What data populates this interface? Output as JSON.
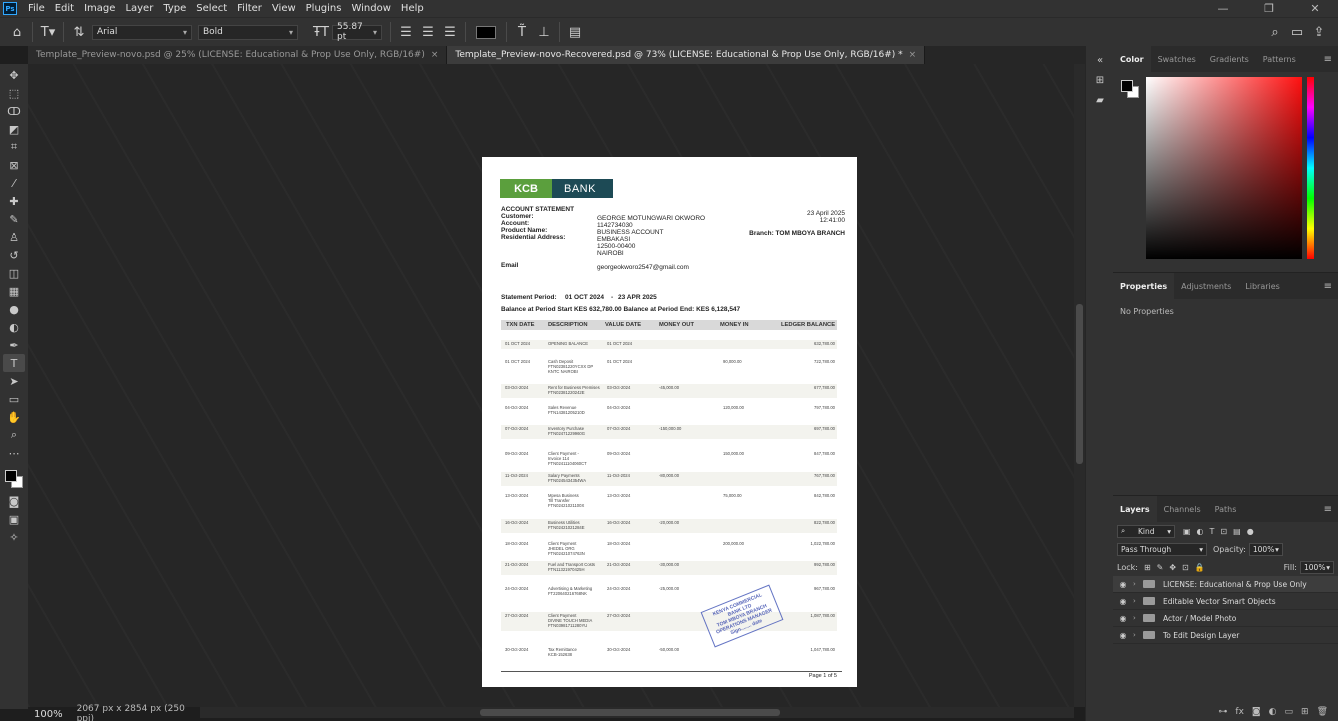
{
  "menu": {
    "app_logo": "Ps",
    "items": [
      "File",
      "Edit",
      "Image",
      "Layer",
      "Type",
      "Select",
      "Filter",
      "View",
      "Plugins",
      "Window",
      "Help"
    ]
  },
  "options": {
    "font_family": "Arial",
    "font_style": "Bold",
    "font_size": "55.87 pt",
    "text_color": "#000000"
  },
  "tabs": [
    {
      "label": "Template_Preview-novo.psd @ 25% (LICENSE: Educational & Prop Use Only, RGB/16#)",
      "close": "×"
    },
    {
      "label": "Template_Preview-novo-Recovered.psd @ 73% (LICENSE: Educational & Prop Use Only, RGB/16#) *",
      "close": "×"
    }
  ],
  "status": {
    "zoom": "100%",
    "dims": "2067 px x 2854 px (250 ppi)"
  },
  "document": {
    "logo": {
      "kcb": "KCB",
      "bank": "BANK"
    },
    "title": "ACCOUNT STATEMENT",
    "labels": {
      "customer": "Customer:",
      "account": "Account:",
      "product": "Product Name:",
      "address": "Residential Address:",
      "email": "Email"
    },
    "values": {
      "customer": "GEORGE MOTUNGWARI OKWORO",
      "account": "1142734030",
      "product": "BUSINESS ACCOUNT",
      "addr1": "EMBAKASI",
      "addr2": "12500-00400",
      "addr3": "NAIROBI",
      "email": "georgeokworo2547@gmail.com"
    },
    "date": "23 April 2025",
    "time": "12:41:00",
    "branch": "Branch: TOM MBOYA BRANCH",
    "period_label": "Statement Period:",
    "period_from": "01 OCT 2024",
    "period_sep": "-",
    "period_to": "23 APR 2025",
    "balance_line": "Balance at Period Start  KES 632,780.00 Balance at Period End: KES 6,128,547",
    "headers": [
      "TXN DATE",
      "DESCRIPTION",
      "VALUE DATE",
      "MONEY OUT",
      "MONEY IN",
      "LEDGER BALANCE"
    ],
    "rows": [
      {
        "txn": "01 OCT 2024",
        "desc": [
          "OPENING BALANCE"
        ],
        "value": "01 OCT 2024",
        "out": "",
        "in": "",
        "bal": "632,780.00"
      },
      {
        "txn": "01 OCT 2024",
        "desc": [
          "Cash Deposit",
          "FTN02381220YCXX  DP",
          "KNTC NAIROBI"
        ],
        "value": "01 OCT 2024",
        "out": "",
        "in": "90,000.00",
        "bal": "722,780.00"
      },
      {
        "txn": "03-Oct-2024",
        "desc": [
          "Rent for Business Premises",
          "FTN02381220242E"
        ],
        "value": "03-Oct-2024",
        "out": "-45,000.00",
        "in": "",
        "bal": "677,780.00"
      },
      {
        "txn": "04-Oct-2024",
        "desc": [
          "Sales Revenue",
          "FTN14381205210D"
        ],
        "value": "04-Oct-2024",
        "out": "",
        "in": "120,000.00",
        "bal": "797,780.00"
      },
      {
        "txn": "07-Oct-2024",
        "desc": [
          "Inventory Purchase",
          "FTN02471229960G"
        ],
        "value": "07-Oct-2024",
        "out": "-150,000.00",
        "in": "",
        "bal": "697,780.00"
      },
      {
        "txn": "09-Oct-2024",
        "desc": [
          "Client Payment -",
          "Invoice 114",
          "FTN02411104060CT"
        ],
        "value": "09-Oct-2024",
        "out": "",
        "in": "150,000.00",
        "bal": "847,780.00"
      },
      {
        "txn": "11-Oct-2024",
        "desc": [
          "Salary Payments",
          "FTN0245434354WA"
        ],
        "value": "11-Oct-2024",
        "out": "-80,000.00",
        "in": "",
        "bal": "767,780.00"
      },
      {
        "txn": "13-Oct-2024",
        "desc": [
          "Mpesa Business",
          "Till Transfer",
          "FTN02421021100X"
        ],
        "value": "13-Oct-2024",
        "out": "",
        "in": "75,000.00",
        "bal": "842,780.00"
      },
      {
        "txn": "16-Oct-2024",
        "desc": [
          "Business Utilities",
          "FTN02421021284E"
        ],
        "value": "16-Oct-2024",
        "out": "-20,000.00",
        "in": "",
        "bal": "822,780.00"
      },
      {
        "txn": "18-Oct-2024",
        "desc": [
          "Client Payment",
          "JHEDEL ORG",
          "FTN02421074763N"
        ],
        "value": "18-Oct-2024",
        "out": "",
        "in": "200,000.00",
        "bal": "1,022,780.00"
      },
      {
        "txn": "21-Oct-2024",
        "desc": [
          "Fuel and Transport Costs",
          "FTN11321970425H"
        ],
        "value": "21-Oct-2024",
        "out": "-30,000.00",
        "in": "",
        "bal": "992,780.00"
      },
      {
        "txn": "24-Oct-2024",
        "desc": [
          "Advertising & Marketing",
          "FT220640216768NK"
        ],
        "value": "24-Oct-2024",
        "out": "-25,000.00",
        "in": "",
        "bal": "967,780.00"
      },
      {
        "txn": "27-Oct-2024",
        "desc": [
          "Client Payment",
          "DIVINE TOUCH MEDIA",
          "FTN03981711280YU"
        ],
        "value": "27-Oct-2024",
        "out": "",
        "in": "",
        "bal": "1,087,780.00"
      },
      {
        "txn": "30-Oct-2024",
        "desc": [
          "Tax Remittance",
          "KCB-152638"
        ],
        "value": "30-Oct-2024",
        "out": "-50,000.00",
        "in": "",
        "bal": "1,047,780.00"
      }
    ],
    "stamp": [
      "KENYA COMMERCIAL BANK LTD",
      "TOM MBOYA BRANCH",
      "OPERATIONS MANAGER",
      "Sign........ date"
    ],
    "page_num": "Page 1 of 5"
  },
  "color_panel": {
    "tabs": [
      "Color",
      "Swatches",
      "Gradients",
      "Patterns"
    ]
  },
  "props_panel": {
    "tabs": [
      "Properties",
      "Adjustments",
      "Libraries"
    ],
    "empty": "No Properties"
  },
  "layers_panel": {
    "tabs": [
      "Layers",
      "Channels",
      "Paths"
    ],
    "filter": "Kind",
    "blend": "Pass Through",
    "opacity_label": "Opacity:",
    "opacity": "100%",
    "lock_label": "Lock:",
    "fill_label": "Fill:",
    "fill": "100%",
    "layers": [
      "LICENSE: Educational & Prop Use Only",
      "Editable Vector Smart Objects",
      "Actor / Model Photo",
      "To Edit Design Layer"
    ]
  }
}
